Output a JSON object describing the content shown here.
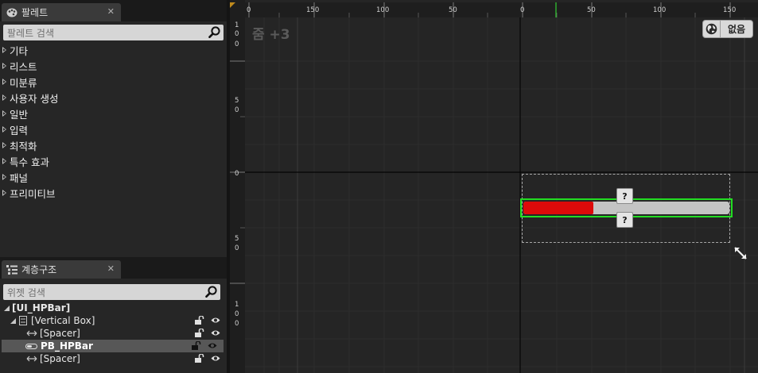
{
  "palette": {
    "tab_label": "팔레트",
    "close_glyph": "✕",
    "search_placeholder": "팔레트 검색",
    "categories": [
      "기타",
      "리스트",
      "미분류",
      "사용자 생성",
      "일반",
      "입력",
      "최적화",
      "특수 효과",
      "패널",
      "프리미티브"
    ]
  },
  "hierarchy": {
    "tab_label": "계층구조",
    "close_glyph": "✕",
    "search_placeholder": "위젯 검색",
    "items": [
      {
        "label": "[UI_HPBar]"
      },
      {
        "label": "[Vertical Box]"
      },
      {
        "label": "[Spacer]"
      },
      {
        "label": "PB_HPBar"
      },
      {
        "label": "[Spacer]"
      }
    ]
  },
  "designer": {
    "zoom_label": "줌 +3",
    "dpi_label": "없음",
    "ruler_h_labels": [
      "0",
      "150",
      "100",
      "50",
      "0",
      "50",
      "100",
      "150"
    ],
    "ruler_v_labels": [
      "1\n0\n0",
      "5\n0",
      "0",
      "5\n0",
      "1\n0\n0"
    ],
    "anchor_glyph": "?",
    "progress_fill": 0.34,
    "colors": {
      "fill": "#dd0a0a",
      "selection": "#22dd22",
      "bar_bg": "#c4c4c4",
      "marker": "#32cd32"
    }
  }
}
